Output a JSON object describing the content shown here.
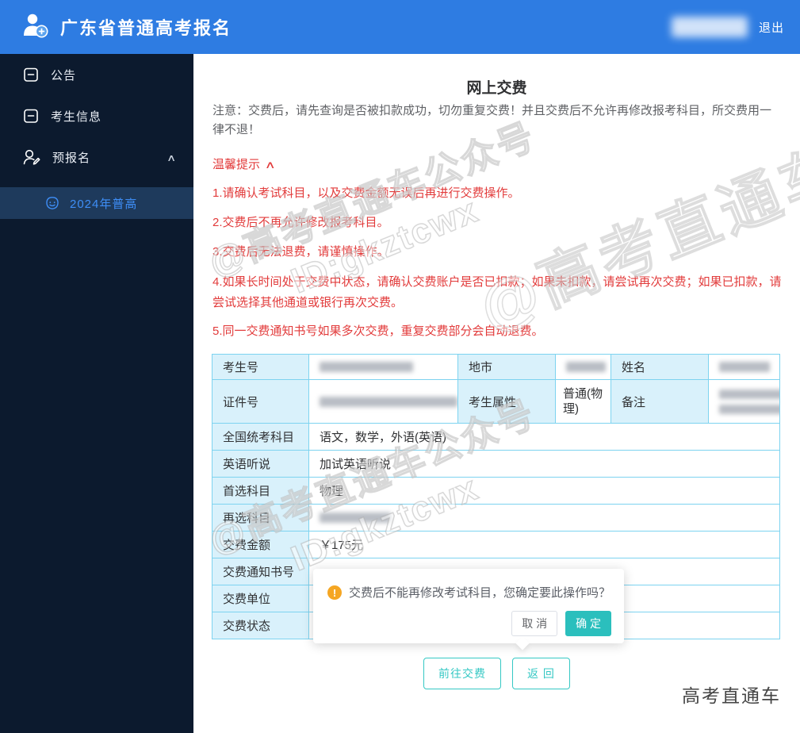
{
  "header": {
    "app_title": "广东省普通高考报名",
    "logout_label": "退出"
  },
  "sidebar": {
    "items": [
      {
        "label": "公告",
        "icon": "bulletin-icon"
      },
      {
        "label": "考生信息",
        "icon": "bulletin-icon"
      },
      {
        "label": "预报名",
        "icon": "user-edit-icon",
        "expanded": true
      }
    ],
    "submenu": [
      {
        "label": "2024年普高",
        "icon": "face-icon",
        "active": true
      }
    ]
  },
  "content": {
    "page_title": "网上交费",
    "notice": "注意：交费后，请先查询是否被扣款成功，切勿重复交费！并且交费后不允许再修改报考科目，所交费用一律不退！",
    "tips_title": "温馨提示",
    "tips": [
      "1.请确认考试科目，以及交费金额无误后再进行交费操作。",
      "2.交费后不再允许修改报考科目。",
      "3.交费后无法退费，请谨慎操作。",
      "4.如果长时间处于交费中状态，请确认交费账户是否已扣款；如果未扣款，请尝试再次交费；如果已扣款，请尝试选择其他通道或银行再次交费。",
      "5.同一交费通知书号如果多次交费，重复交费部分会自动退费。"
    ]
  },
  "info_table": {
    "row1": {
      "label1": "考生号",
      "label2": "地市",
      "label3": "姓名"
    },
    "row2": {
      "label1": "证件号",
      "label2": "考生属性",
      "value2": "普通(物理)",
      "label3": "备注"
    },
    "rows": [
      {
        "label": "全国统考科目",
        "value": "语文，数学，外语(英语)"
      },
      {
        "label": "英语听说",
        "value": "加试英语听说"
      },
      {
        "label": "首选科目",
        "value": "物理"
      },
      {
        "label": "再选科目",
        "value": ""
      },
      {
        "label": "交费金额",
        "value": "￥175元"
      },
      {
        "label": "交费通知书号",
        "value": ""
      },
      {
        "label": "交费单位",
        "value": ""
      },
      {
        "label": "交费状态",
        "value": ""
      }
    ]
  },
  "dialog": {
    "message": "交费后不能再修改考试科目，您确定要此操作吗？",
    "warning_glyph": "!",
    "cancel_label": "取 消",
    "confirm_label": "确 定"
  },
  "actions": {
    "pay_label": "前往交费",
    "back_label": "返 回"
  },
  "watermark": {
    "line1": "@高考直通车公众号",
    "line2": "ID:gkztcwx",
    "brand": "高考直通车"
  },
  "icons": {
    "collapse_caret": "∧"
  },
  "colors": {
    "header_blue": "#2e7ce2",
    "sidebar_navy": "#0c1a2e",
    "active_item_navy": "#1e3a5c",
    "link_blue": "#3e8ef7",
    "tip_red": "#e23b3b",
    "table_border": "#7dd3f0",
    "label_cell_bg": "#d9f1fb",
    "confirm_teal": "#2bbfbd",
    "warning_orange": "#f5a623"
  }
}
